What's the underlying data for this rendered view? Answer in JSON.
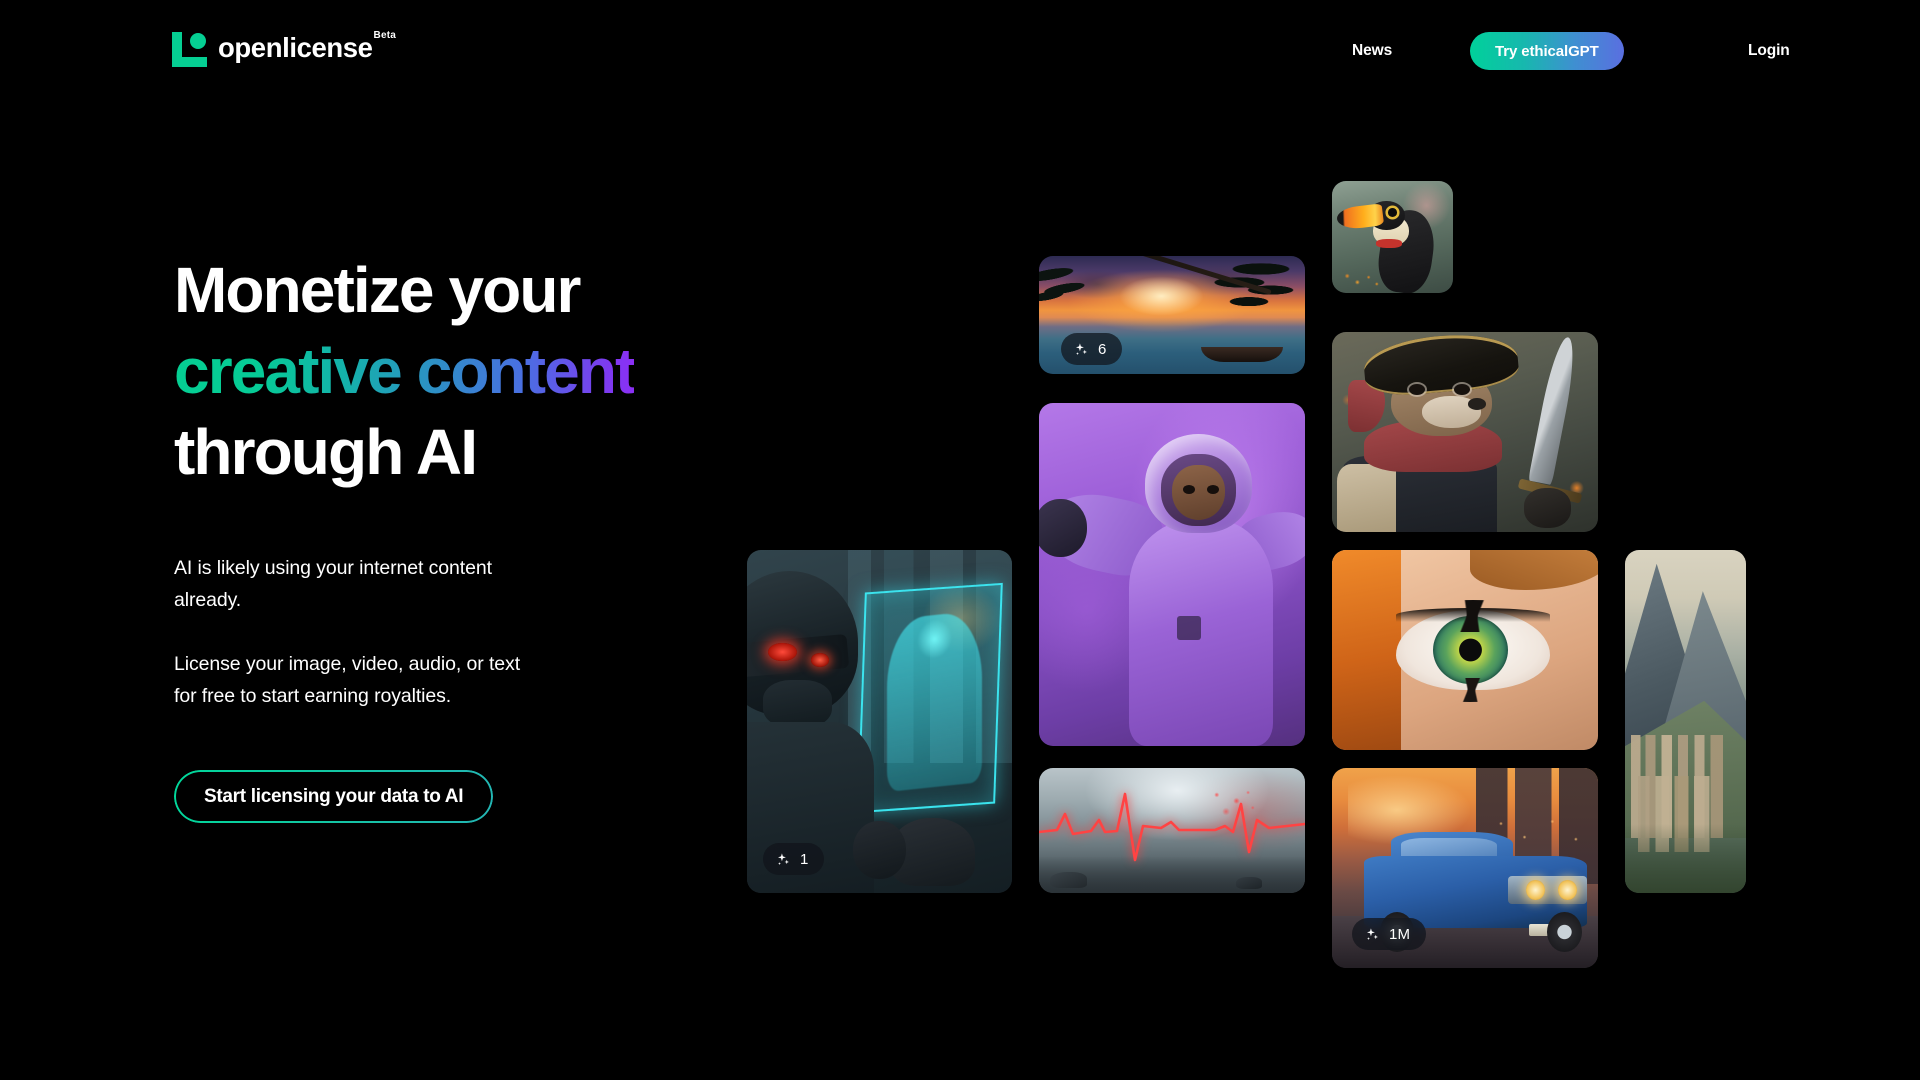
{
  "brand": {
    "name": "openlicense",
    "badge": "Beta",
    "logo_icon": "openlicense-l-mark-icon",
    "accent_green": "#05cf93"
  },
  "nav": {
    "news_label": "News",
    "cta_label": "Try ethicalGPT",
    "login_label": "Login",
    "cta_gradient_from": "#00d19a",
    "cta_gradient_to": "#5a6fe0"
  },
  "hero": {
    "headline_line1": "Monetize your",
    "headline_line2": "creative content",
    "headline_line3": "through AI",
    "headline_gradient_from": "#05cf93",
    "headline_gradient_to": "#8b2ff5",
    "paragraph_1": "AI is likely using your internet content already.",
    "paragraph_2": "License your image, video, audio, or text for free to start earning royalties.",
    "cta_label": "Start licensing your data to AI",
    "cta_border_from": "#00d89a",
    "cta_border_to": "#23b6b4"
  },
  "gallery": {
    "badge_icon": "sparkles-icon",
    "tiles": [
      {
        "name": "beach-sunset",
        "alt": "Tropical beach at sunset with palm trees and a canoe",
        "badge": "6"
      },
      {
        "name": "toucan",
        "alt": "Toucan bird perched on a branch in a jungle",
        "badge": null
      },
      {
        "name": "astronaut",
        "alt": "Purple-suited astronaut reaching toward the camera",
        "badge": null
      },
      {
        "name": "pirate-otter",
        "alt": "Otter dressed as a pirate holding a cutlass",
        "badge": null
      },
      {
        "name": "cyberpunk-soldier",
        "alt": "Cyberpunk soldier with red visor holding a hologram",
        "badge": "1"
      },
      {
        "name": "green-eye",
        "alt": "Close-up of a green eye with red hair",
        "badge": null
      },
      {
        "name": "mountain-village",
        "alt": "Stone village on a mountainside",
        "badge": null
      },
      {
        "name": "ecg-waveform",
        "alt": "Red ECG heartbeat line over a misty landscape",
        "badge": null
      },
      {
        "name": "lowrider-car",
        "alt": "Blue classic lowrider car on a street at sunset",
        "badge": "1M"
      }
    ]
  }
}
